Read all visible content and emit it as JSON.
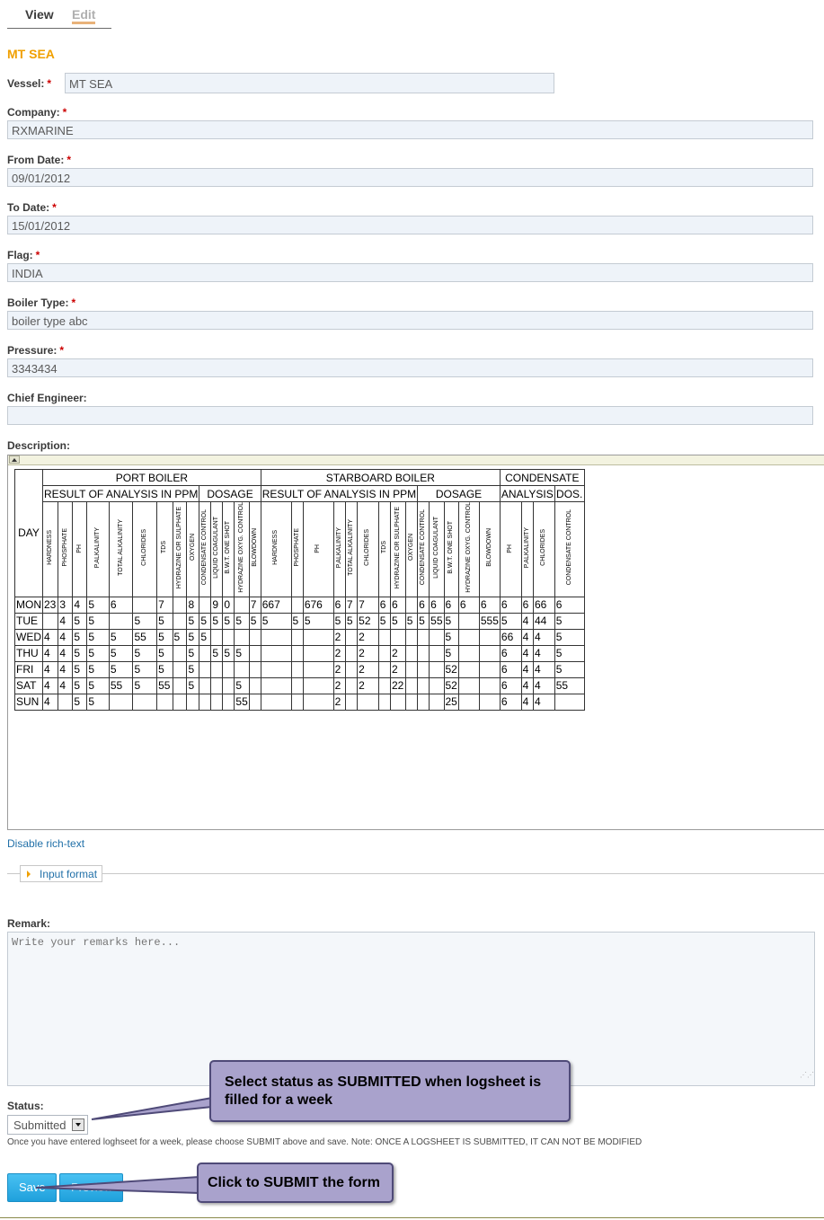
{
  "tabs": {
    "view": "View",
    "edit": "Edit"
  },
  "page_title": "MT SEA",
  "fields": {
    "vessel": {
      "label": "Vessel:",
      "value": "MT SEA"
    },
    "company": {
      "label": "Company:",
      "value": "RXMARINE"
    },
    "from_date": {
      "label": "From Date:",
      "value": "09/01/2012"
    },
    "to_date": {
      "label": "To Date:",
      "value": "15/01/2012"
    },
    "flag": {
      "label": "Flag:",
      "value": "INDIA"
    },
    "boiler_type": {
      "label": "Boiler Type:",
      "value": "boiler type abc"
    },
    "pressure": {
      "label": "Pressure:",
      "value": "3343434"
    },
    "chief_engineer": {
      "label": "Chief Engineer:",
      "value": ""
    }
  },
  "required_mark": "*",
  "description": {
    "label": "Description:",
    "table": {
      "group_headers": [
        "PORT BOILER",
        "STARBOARD BOILER",
        "CONDENSATE"
      ],
      "sub_headers": [
        "RESULT OF ANALYSIS IN PPM",
        "DOSAGE",
        "RESULT OF ANALYSIS IN PPM",
        "DOSAGE",
        "ANALYSIS",
        "DOS."
      ],
      "day_header": "DAY",
      "columns": [
        "HARDNESS",
        "PHOSPHATE",
        "PH",
        "P.ALKALINITY",
        "TOTAL ALKALINITY",
        "CHLORIDES",
        "TDS",
        "HYDRAZINE OR SULPHATE",
        "OXYGEN",
        "CONDENSATE CONTROL",
        "LIQUID COAGULANT",
        "B.W.T. ONE SHOT",
        "HYDRAZINE OXYG. CONTROL",
        "BLOWDOWN",
        "HARDNESS",
        "PHOSPHATE",
        "PH",
        "P.ALKALINITY",
        "TOTAL ALKALINITY",
        "CHLORIDES",
        "TDS",
        "HYDRAZINE OR SULPHATE",
        "OXYGEN",
        "CONDENSATE CONTROL",
        "LIQUID COAGULANT",
        "B.W.T. ONE SHOT",
        "HYDRAZINE OXYG. CONTROL",
        "BLOWDOWN",
        "PH",
        "P.ALKALINITY",
        "CHLORIDES",
        "CONDENSATE CONTROL"
      ],
      "rows": [
        {
          "day": "MON",
          "cells": [
            "23",
            "3",
            "4",
            "5",
            "6",
            "",
            "7",
            "",
            "8",
            "",
            "9",
            "0",
            "",
            "7",
            "667",
            "",
            "676",
            "6",
            "7",
            "7",
            "6",
            "6",
            "",
            "6",
            "6",
            "6",
            "6",
            "6",
            "6",
            "6",
            "66",
            "6"
          ]
        },
        {
          "day": "TUE",
          "cells": [
            "",
            "4",
            "5",
            "5",
            "",
            "5",
            "5",
            "",
            "5",
            "5",
            "5",
            "5",
            "5",
            "5",
            "5",
            "5",
            "5",
            "5",
            "5",
            "52",
            "5",
            "5",
            "5",
            "5",
            "55",
            "5",
            "",
            "555",
            "5",
            "4",
            "44",
            "5"
          ]
        },
        {
          "day": "WED",
          "cells": [
            "4",
            "4",
            "5",
            "5",
            "5",
            "55",
            "5",
            "5",
            "5",
            "5",
            "",
            "",
            "",
            "",
            "",
            "",
            "",
            "2",
            "",
            "2",
            "",
            "",
            "",
            "",
            "",
            "5",
            "",
            "",
            "66",
            "4",
            "4",
            "5"
          ]
        },
        {
          "day": "THU",
          "cells": [
            "4",
            "4",
            "5",
            "5",
            "5",
            "5",
            "5",
            "",
            "5",
            "",
            "5",
            "5",
            "5",
            "",
            "",
            "",
            "",
            "2",
            "",
            "2",
            "",
            "2",
            "",
            "",
            "",
            "5",
            "",
            "",
            "6",
            "4",
            "4",
            "5"
          ]
        },
        {
          "day": "FRI",
          "cells": [
            "4",
            "4",
            "5",
            "5",
            "5",
            "5",
            "5",
            "",
            "5",
            "",
            "",
            "",
            "",
            "",
            "",
            "",
            "",
            "2",
            "",
            "2",
            "",
            "2",
            "",
            "",
            "",
            "52",
            "",
            "",
            "6",
            "4",
            "4",
            "5"
          ]
        },
        {
          "day": "SAT",
          "cells": [
            "4",
            "4",
            "5",
            "5",
            "55",
            "5",
            "55",
            "",
            "5",
            "",
            "",
            "",
            "5",
            "",
            "",
            "",
            "",
            "2",
            "",
            "2",
            "",
            "22",
            "",
            "",
            "",
            "52",
            "",
            "",
            "6",
            "4",
            "4",
            "55"
          ]
        },
        {
          "day": "SUN",
          "cells": [
            "4",
            "",
            "5",
            "5",
            "",
            "",
            "",
            "",
            "",
            "",
            "",
            "",
            "55",
            "",
            "",
            "",
            "",
            "2",
            "",
            "",
            "",
            "",
            "",
            "",
            "",
            "25",
            "",
            "",
            "6",
            "4",
            "4",
            ""
          ]
        }
      ]
    }
  },
  "disable_rich_text": "Disable rich-text",
  "input_format": "Input format",
  "remark": {
    "label": "Remark:",
    "placeholder": "Write your remarks here..."
  },
  "status": {
    "label": "Status:",
    "value": "Submitted"
  },
  "help_text": "Once you have entered loghseet for a week, please choose SUBMIT above and save. Note: ONCE A LOGSHEET IS SUBMITTED, IT CAN NOT BE MODIFIED",
  "buttons": {
    "save": "Save",
    "preview": "Preview"
  },
  "callouts": {
    "status": "Select status as SUBMITTED when logsheet is filled for a week",
    "submit": "Click to SUBMIT the form"
  }
}
